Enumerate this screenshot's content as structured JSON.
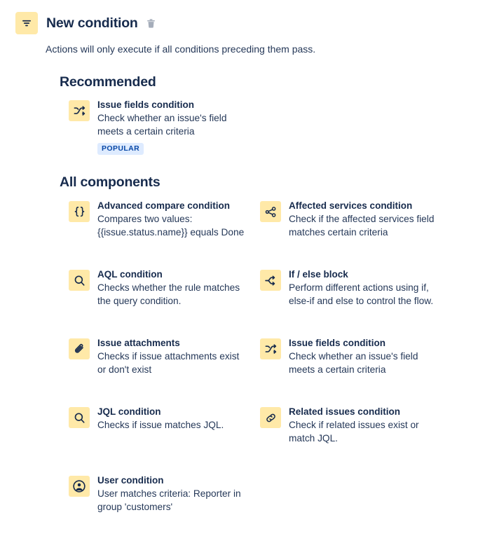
{
  "header": {
    "icon": "filter-icon",
    "title": "New condition",
    "delete_icon": "trash-icon"
  },
  "subtitle": "Actions will only execute if all conditions preceding them pass.",
  "sections": {
    "recommended": {
      "title": "Recommended",
      "items": [
        {
          "icon": "shuffle-icon",
          "name": "Issue fields condition",
          "desc": "Check whether an issue's field meets a certain criteria",
          "badge": "POPULAR"
        }
      ]
    },
    "all_components": {
      "title": "All components",
      "items": [
        {
          "icon": "curly-braces-icon",
          "name": "Advanced compare condition",
          "desc": "Compares two values: {{issue.status.name}} equals Done"
        },
        {
          "icon": "share-nodes-icon",
          "name": "Affected services condition",
          "desc": "Check if the affected services field matches certain criteria"
        },
        {
          "icon": "search-icon",
          "name": "AQL condition",
          "desc": "Checks whether the rule matches the query condition."
        },
        {
          "icon": "branch-icon",
          "name": "If / else block",
          "desc": "Perform different actions using if, else-if and else to control the flow."
        },
        {
          "icon": "paperclip-icon",
          "name": "Issue attachments",
          "desc": "Checks if issue attachments exist or don't exist"
        },
        {
          "icon": "shuffle-icon",
          "name": "Issue fields condition",
          "desc": "Check whether an issue's field meets a certain criteria"
        },
        {
          "icon": "search-icon",
          "name": "JQL condition",
          "desc": "Checks if issue matches JQL."
        },
        {
          "icon": "link-icon",
          "name": "Related issues condition",
          "desc": "Check if related issues exist or match JQL."
        },
        {
          "icon": "person-circle-icon",
          "name": "User condition",
          "desc": "User matches criteria: Reporter in group 'customers'"
        }
      ]
    }
  },
  "colors": {
    "icon_tile_bg": "#FFE9A8",
    "icon_glyph": "#172B4D",
    "text_primary": "#172B4D",
    "text_secondary": "#253858",
    "badge_bg": "#DEEBFF",
    "badge_text": "#0747A6",
    "page_bg": "#FFFFFF"
  }
}
